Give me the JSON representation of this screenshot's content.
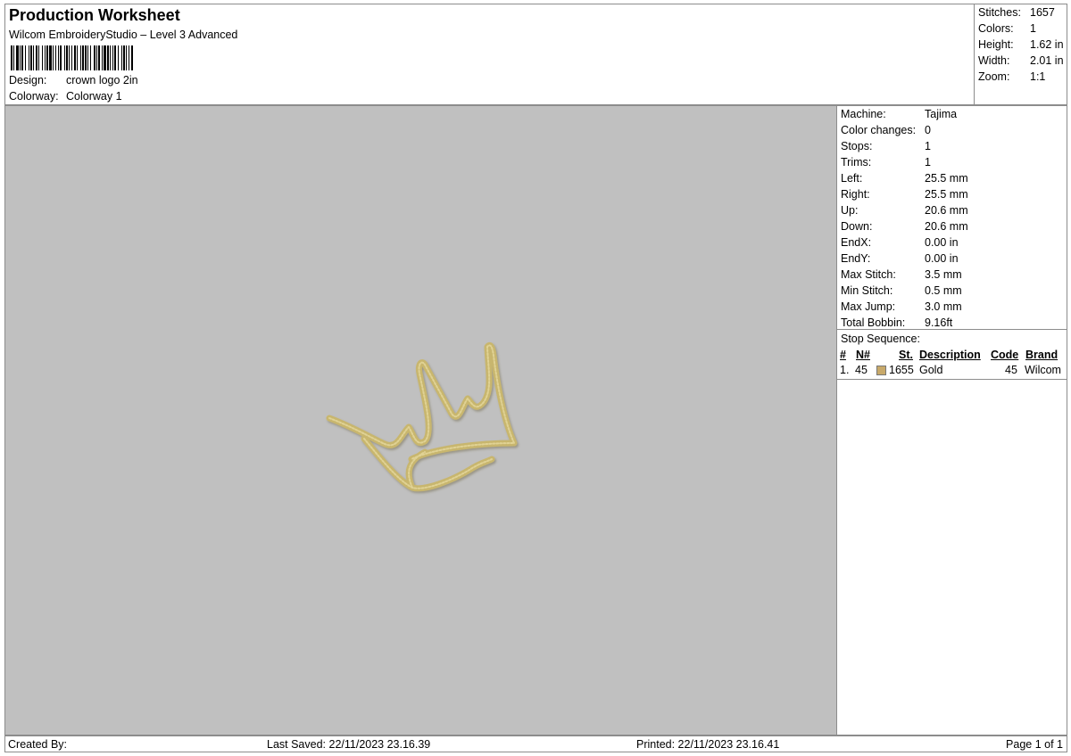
{
  "header": {
    "title": "Production Worksheet",
    "subtitle": "Wilcom EmbroideryStudio – Level 3 Advanced",
    "design_label": "Design:",
    "design_value": "crown logo 2in",
    "colorway_label": "Colorway:",
    "colorway_value": "Colorway 1"
  },
  "summary": {
    "stitches_label": "Stitches:",
    "stitches_value": "1657",
    "colors_label": "Colors:",
    "colors_value": "1",
    "height_label": "Height:",
    "height_value": "1.62 in",
    "width_label": "Width:",
    "width_value": "2.01 in",
    "zoom_label": "Zoom:",
    "zoom_value": "1:1"
  },
  "machine": {
    "rows": [
      {
        "label": "Machine:",
        "value": "Tajima"
      },
      {
        "label": "Color changes:",
        "value": "0"
      },
      {
        "label": "Stops:",
        "value": "1"
      },
      {
        "label": "Trims:",
        "value": "1"
      },
      {
        "label": "Left:",
        "value": "25.5 mm"
      },
      {
        "label": "Right:",
        "value": "25.5 mm"
      },
      {
        "label": "Up:",
        "value": "20.6 mm"
      },
      {
        "label": "Down:",
        "value": "20.6 mm"
      },
      {
        "label": "EndX:",
        "value": "0.00 in"
      },
      {
        "label": "EndY:",
        "value": "0.00 in"
      },
      {
        "label": "Max Stitch:",
        "value": "3.5 mm"
      },
      {
        "label": "Min Stitch:",
        "value": "0.5 mm"
      },
      {
        "label": "Max Jump:",
        "value": "3.0 mm"
      },
      {
        "label": "Total Bobbin:",
        "value": "9.16ft"
      }
    ]
  },
  "stop_sequence": {
    "title": "Stop Sequence:",
    "columns": {
      "num": "#",
      "n": "N#",
      "st": "St.",
      "description": "Description",
      "code": "Code",
      "brand": "Brand"
    },
    "rows": [
      {
        "num": "1.",
        "n": "45",
        "swatch_color": "#c8a96a",
        "st": "1655",
        "description": "Gold",
        "code": "45",
        "brand": "Wilcom"
      }
    ]
  },
  "design_preview": {
    "background": "#c0c0c0",
    "thread_color": "#c8b66e"
  },
  "footer": {
    "created_by": "Created By:",
    "last_saved": "Last Saved: 22/11/2023 23.16.39",
    "printed": "Printed: 22/11/2023 23.16.41",
    "page": "Page 1 of 1"
  }
}
